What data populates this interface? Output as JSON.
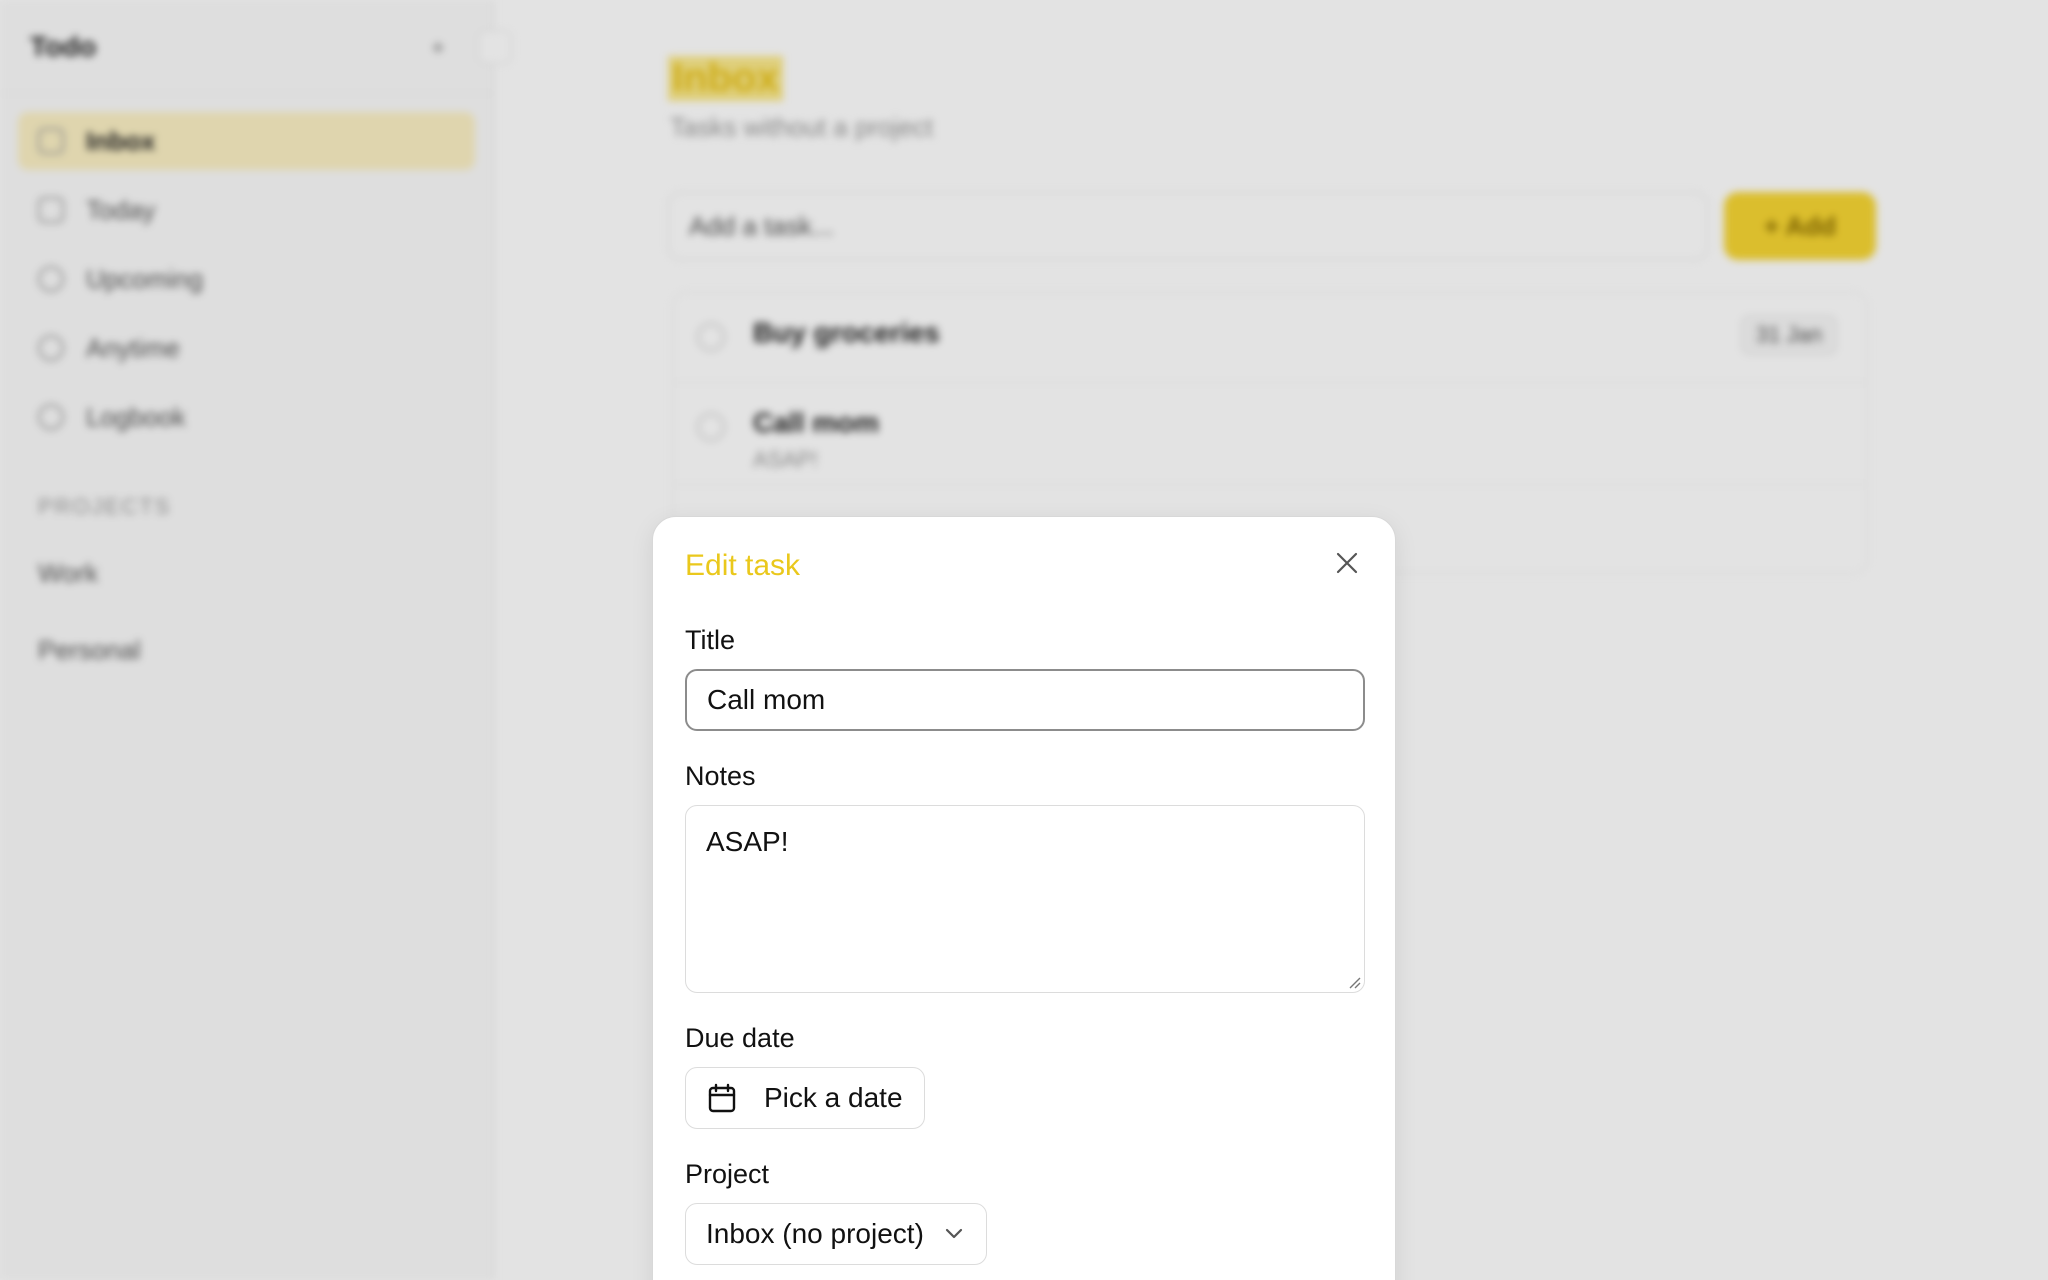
{
  "sidebar": {
    "app_title": "Todo",
    "nav": [
      {
        "label": "Inbox",
        "icon": "inbox-icon",
        "active": true
      },
      {
        "label": "Today",
        "icon": "calendar-icon"
      },
      {
        "label": "Upcoming",
        "icon": "sparkle-icon"
      },
      {
        "label": "Anytime",
        "icon": "clock-icon"
      },
      {
        "label": "Logbook",
        "icon": "check-circle-icon"
      }
    ],
    "projects_label": "PROJECTS",
    "projects": [
      "Work",
      "Personal"
    ]
  },
  "main": {
    "title": "Inbox",
    "subtitle": "Tasks without a project",
    "add_placeholder": "Add a task...",
    "add_button": "Add",
    "tasks": [
      {
        "title": "Buy groceries",
        "date": "31 Jan"
      },
      {
        "title": "Call mom",
        "note": "ASAP!"
      }
    ]
  },
  "dialog": {
    "title": "Edit task",
    "title_label": "Title",
    "title_value": "Call mom",
    "notes_label": "Notes",
    "notes_value": "ASAP!",
    "due_label": "Due date",
    "due_button": "Pick a date",
    "project_label": "Project",
    "project_value": "Inbox (no project)"
  },
  "colors": {
    "accent": "#eac81c",
    "accent_bg": "#fbf0c4",
    "overlay": "rgba(0,0,0,0.11)"
  }
}
